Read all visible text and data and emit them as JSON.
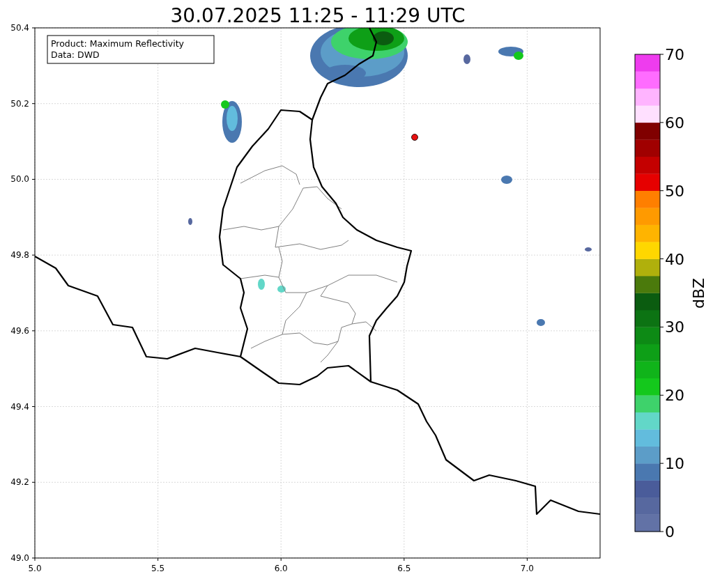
{
  "title": "30.07.2025 11:25 - 11:29 UTC",
  "legend": [
    "Product: Maximum Reflectivity",
    "Data: DWD"
  ],
  "map": {
    "xticks": [
      "5.0",
      "5.5",
      "6.0",
      "6.5",
      "7.0"
    ],
    "yticks": [
      "50.4",
      "50.2",
      "50.0",
      "49.8",
      "49.6",
      "49.4",
      "49.2",
      "49.0"
    ]
  },
  "colorbar": {
    "label": "dBZ",
    "ticks": [
      "70",
      "60",
      "50",
      "40",
      "30",
      "20",
      "10",
      "0"
    ],
    "segments": [
      {
        "color": "#6272a6"
      },
      {
        "color": "#57689f"
      },
      {
        "color": "#4a5c9a"
      },
      {
        "color": "#4a78b0"
      },
      {
        "color": "#5c9dc8"
      },
      {
        "color": "#62bcdd"
      },
      {
        "color": "#62d7c8"
      },
      {
        "color": "#3ed26b"
      },
      {
        "color": "#14c81c"
      },
      {
        "color": "#10b41a"
      },
      {
        "color": "#0e9f17"
      },
      {
        "color": "#0d8a15"
      },
      {
        "color": "#0c7313"
      },
      {
        "color": "#0b5c10"
      },
      {
        "color": "#4b7a0c"
      },
      {
        "color": "#b0b00c"
      },
      {
        "color": "#ffd700"
      },
      {
        "color": "#ffb400"
      },
      {
        "color": "#ff9a00"
      },
      {
        "color": "#ff7f00"
      },
      {
        "color": "#e60000"
      },
      {
        "color": "#c40000"
      },
      {
        "color": "#a00000"
      },
      {
        "color": "#800000"
      },
      {
        "color": "#ffe0ff"
      },
      {
        "color": "#ffb4ff"
      },
      {
        "color": "#ff6cff"
      },
      {
        "color": "#ee3cee"
      }
    ]
  }
}
